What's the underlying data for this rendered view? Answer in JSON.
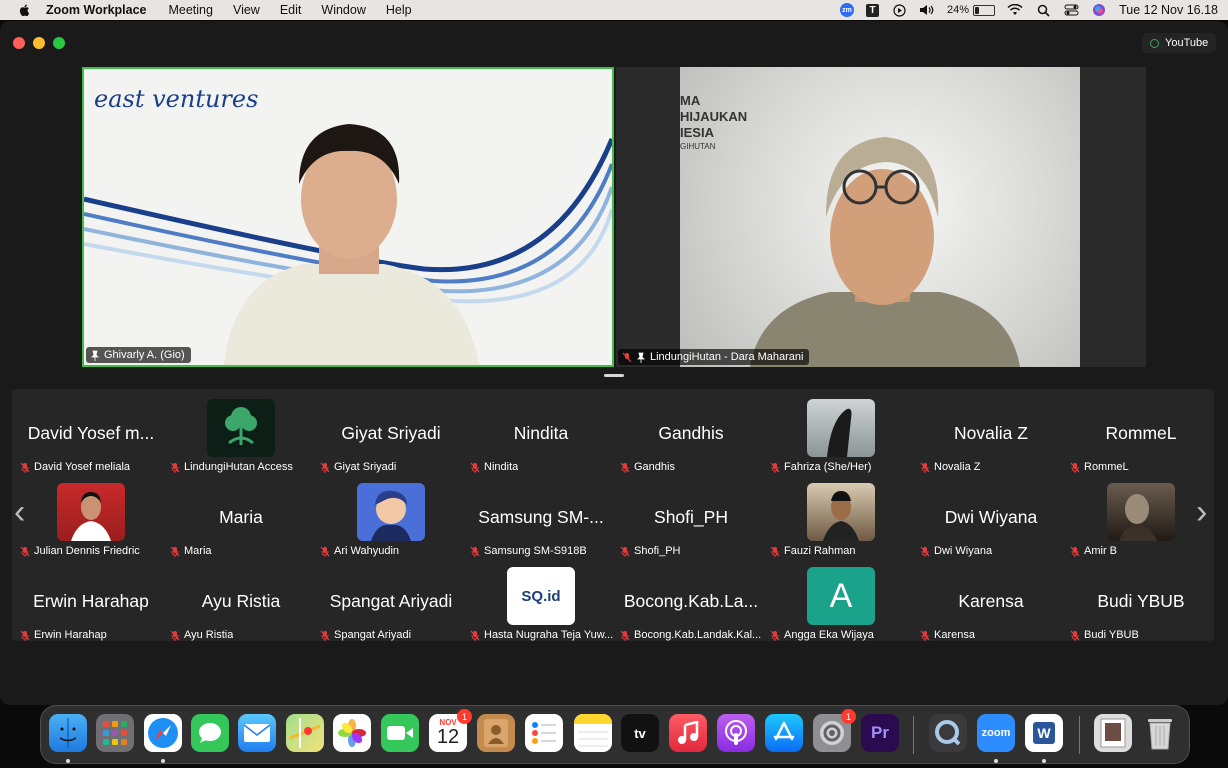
{
  "menubar": {
    "app_name": "Zoom Workplace",
    "items": [
      "Meeting",
      "View",
      "Edit",
      "Window",
      "Help"
    ],
    "battery_text": "24%",
    "battery_level": 0.24,
    "clock": "Tue 12 Nov  16.18"
  },
  "window": {
    "youtube_label": "YouTube"
  },
  "speakers": [
    {
      "name": "Ghivarly A. (Gio)",
      "logo_text": "east ventures",
      "active": true
    },
    {
      "name": "LindungiHutan - Dara Maharani",
      "bg_text_lines": [
        "MA",
        "HIJAUKAN",
        "IESIA",
        "GIHUTAN"
      ]
    }
  ],
  "gallery": {
    "rows": [
      [
        {
          "display": "David Yosef m...",
          "name": "David Yosef meliala"
        },
        {
          "display": "",
          "name": "LindungiHutan Access",
          "avatar": "tree-logo"
        },
        {
          "display": "Giyat Sriyadi",
          "name": "Giyat Sriyadi"
        },
        {
          "display": "Nindita",
          "name": "Nindita"
        },
        {
          "display": "Gandhis",
          "name": "Gandhis"
        },
        {
          "display": "",
          "name": "Fahriza (She/Her)",
          "avatar": "photo-dark"
        },
        {
          "display": "Novalia Z",
          "name": "Novalia Z"
        },
        {
          "display": "RommeL",
          "name": "RommeL"
        }
      ],
      [
        {
          "display": "",
          "name": "Julian Dennis Friedric",
          "avatar": "photo-red"
        },
        {
          "display": "Maria",
          "name": "Maria"
        },
        {
          "display": "",
          "name": "Ari Wahyudin",
          "avatar": "cartoon"
        },
        {
          "display": "Samsung SM-...",
          "name": "Samsung SM-S918B"
        },
        {
          "display": "Shofi_PH",
          "name": "Shofi_PH"
        },
        {
          "display": "",
          "name": "Fauzi Rahman",
          "avatar": "photo-outdoor"
        },
        {
          "display": "Dwi Wiyana",
          "name": "Dwi Wiyana"
        },
        {
          "display": "",
          "name": "Amir B",
          "avatar": "photo-sepia"
        }
      ],
      [
        {
          "display": "Erwin Harahap",
          "name": "Erwin Harahap"
        },
        {
          "display": "Ayu Ristia",
          "name": "Ayu Ristia"
        },
        {
          "display": "Spangat Ariyadi",
          "name": "Spangat Ariyadi"
        },
        {
          "display": "",
          "name": "Hasta Nugraha Teja Yuw...",
          "avatar": "sqid-logo",
          "avatar_text": "SQ.id"
        },
        {
          "display": "Bocong.Kab.La...",
          "name": "Bocong.Kab.Landak.Kal...",
          "avatar": "none"
        },
        {
          "display": "",
          "name": "Angga Eka Wijaya",
          "avatar": "letter",
          "avatar_text": "A"
        },
        {
          "display": "Karensa",
          "name": "Karensa"
        },
        {
          "display": "Budi YBUB",
          "name": "Budi YBUB"
        }
      ]
    ],
    "prev_arrow": "‹",
    "next_arrow": "›"
  },
  "dock": {
    "calendar_month": "NOV",
    "calendar_day": "12",
    "calendar_badge": "1",
    "settings_badge": "1",
    "tv_label": "tv",
    "premiere_label": "Pr",
    "zoom_label": "zoom",
    "word_label": "W"
  }
}
